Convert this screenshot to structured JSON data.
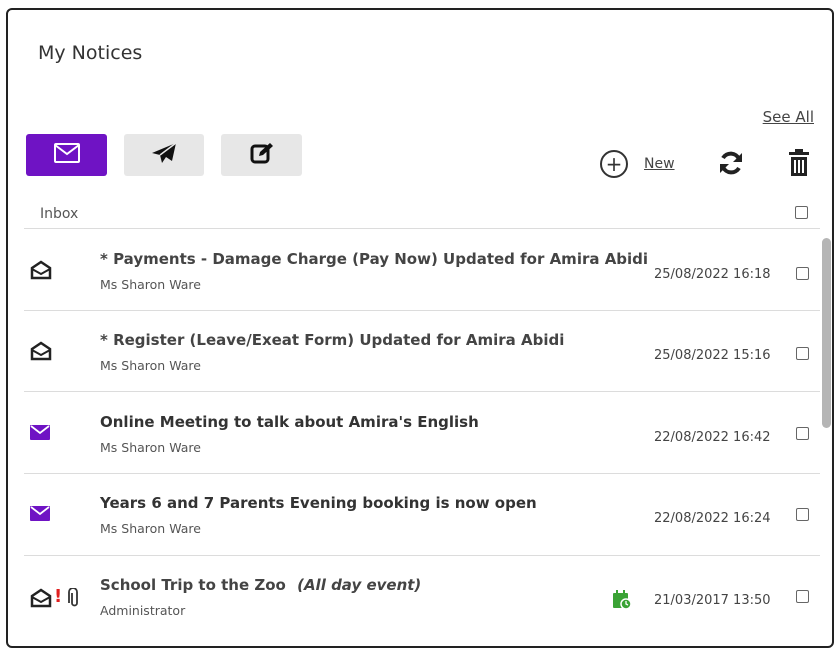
{
  "panel": {
    "title": "My Notices",
    "see_all": "See All",
    "new_label": "New",
    "inbox_label": "Inbox"
  },
  "tabs": [
    {
      "name": "inbox",
      "icon": "envelope-icon",
      "active": true
    },
    {
      "name": "sent",
      "icon": "paper-plane-icon",
      "active": false
    },
    {
      "name": "compose",
      "icon": "edit-icon",
      "active": false
    }
  ],
  "colors": {
    "accent": "#6f13c4",
    "tab_inactive": "#e7e7e7",
    "alert": "#e02020",
    "calendar_green": "#3aa335"
  },
  "messages": [
    {
      "subject": "* Payments - Damage Charge (Pay Now) Updated for Amira Abidi",
      "sender": "Ms Sharon Ware",
      "date": "25/08/2022 16:18",
      "status": "read",
      "icon": "envelope-open-icon"
    },
    {
      "subject": "* Register (Leave/Exeat Form) Updated for Amira Abidi",
      "sender": "Ms Sharon Ware",
      "date": "25/08/2022 15:16",
      "status": "read",
      "icon": "envelope-open-icon"
    },
    {
      "subject": "Online Meeting to talk about Amira's English",
      "sender": "Ms Sharon Ware",
      "date": "22/08/2022 16:42",
      "status": "unread",
      "icon": "envelope-icon"
    },
    {
      "subject": "Years 6 and 7 Parents Evening booking is now open",
      "sender": "Ms Sharon Ware",
      "date": "22/08/2022 16:24",
      "status": "unread",
      "icon": "envelope-icon"
    },
    {
      "subject": "School Trip to the Zoo",
      "subject_extra": "(All day event)",
      "sender": "Administrator",
      "date": "21/03/2017 13:50",
      "status": "read",
      "icon": "envelope-open-icon",
      "flags": [
        "important-icon",
        "attachment-icon",
        "calendar-event-icon"
      ]
    }
  ]
}
